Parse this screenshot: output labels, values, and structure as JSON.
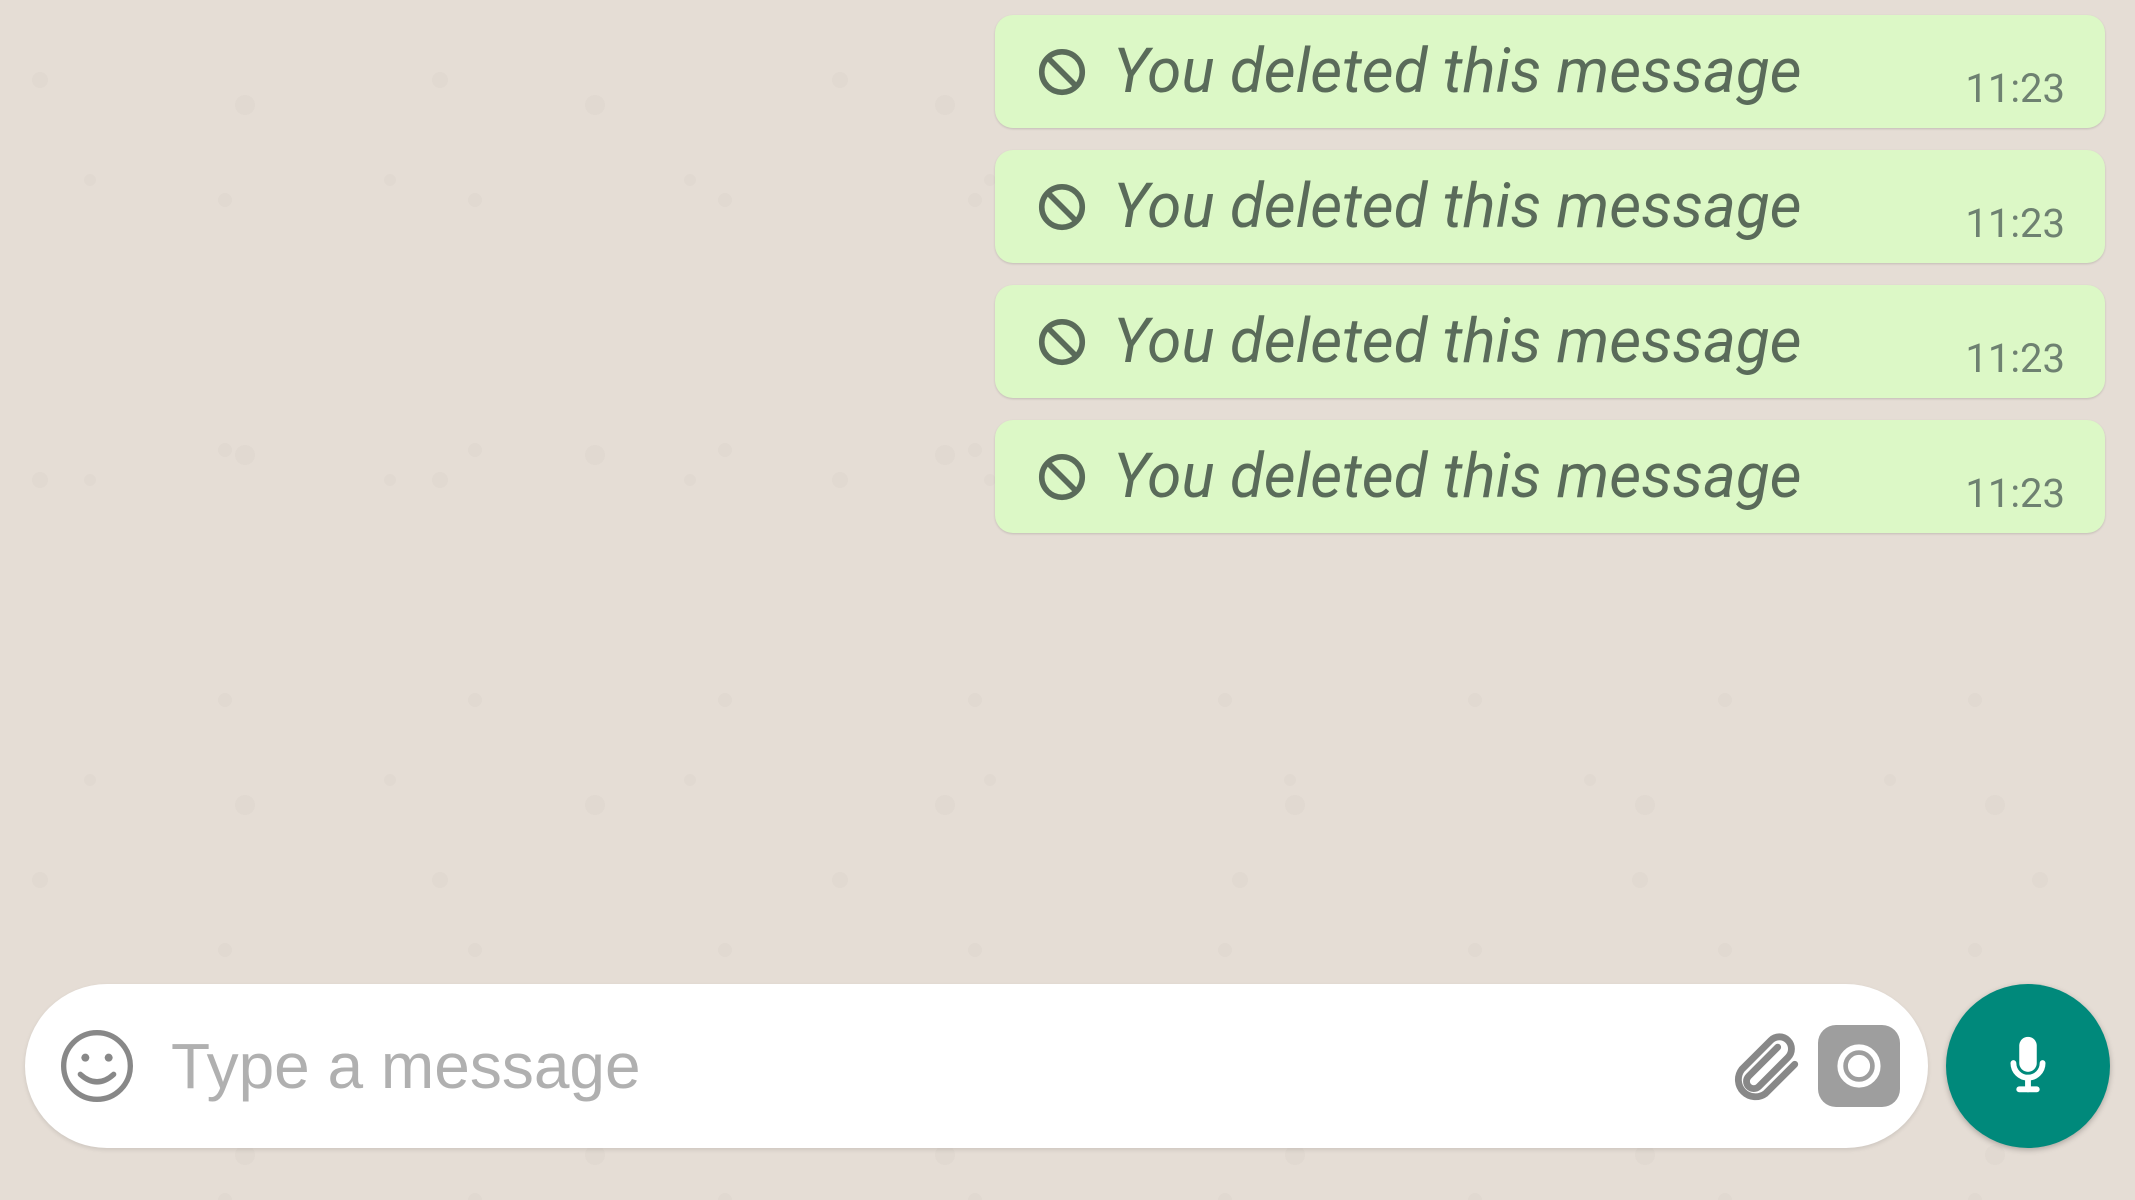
{
  "messages": [
    {
      "text": "You deleted this message",
      "time": "11:23"
    },
    {
      "text": "You deleted this message",
      "time": "11:23"
    },
    {
      "text": "You deleted this message",
      "time": "11:23"
    },
    {
      "text": "You deleted this message",
      "time": "11:23"
    }
  ],
  "input": {
    "placeholder": "Type a message"
  }
}
